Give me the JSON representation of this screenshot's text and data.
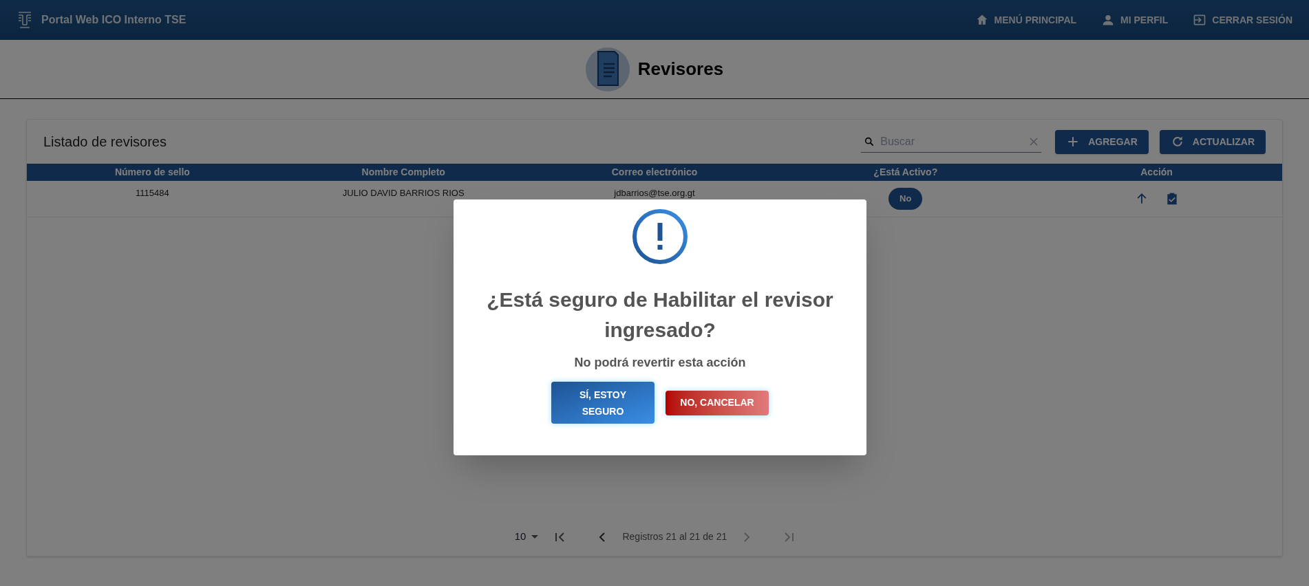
{
  "header": {
    "title": "Portal Web ICO Interno TSE",
    "nav": [
      {
        "kind": "home",
        "label": "MENÚ PRINCIPAL"
      },
      {
        "kind": "profile",
        "label": "MI PERFIL"
      },
      {
        "kind": "logout",
        "label": "CERRAR SESIÓN"
      }
    ]
  },
  "page_title": "Revisores",
  "card": {
    "title": "Listado de revisores",
    "search": {
      "placeholder": "Buscar"
    },
    "buttons": [
      {
        "kind": "add",
        "label": "AGREGAR"
      },
      {
        "kind": "refresh",
        "label": "ACTUALIZAR"
      }
    ]
  },
  "table": {
    "columns": [
      "Número de sello",
      "Nombre Completo",
      "Correo electrónico",
      "¿Está Activo?",
      "Acción"
    ],
    "rows": [
      {
        "stamp": "1115484",
        "name": "JULIO DAVID BARRIOS RIOS",
        "email": "jdbarrios@tse.org.gt",
        "active": false,
        "active_label": "No"
      }
    ]
  },
  "pagination": {
    "page_size": "10",
    "info": "Registros 21 al 21 de 21"
  },
  "dialog": {
    "title": "¿Está seguro de Habilitar el revisor ingresado?",
    "text": "No podrá revertir esta acción",
    "buttons": [
      {
        "kind": "confirm",
        "label": "SÍ, ESTOY SEGURO"
      },
      {
        "kind": "cancel",
        "label": "NO, CANCELAR"
      }
    ]
  }
}
